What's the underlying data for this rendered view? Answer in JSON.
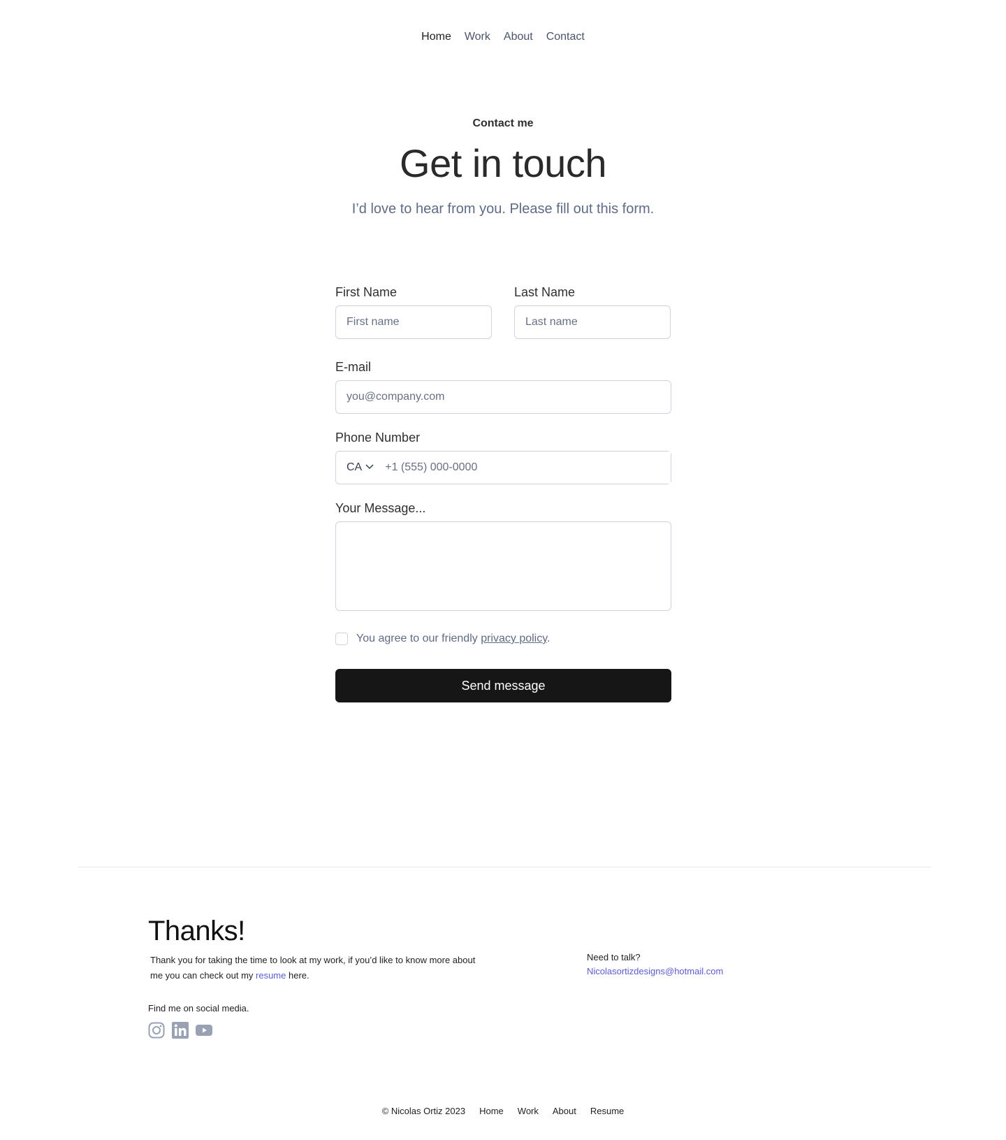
{
  "nav": {
    "items": [
      {
        "label": "Home",
        "active": true
      },
      {
        "label": "Work"
      },
      {
        "label": "About"
      },
      {
        "label": "Contact"
      }
    ]
  },
  "hero": {
    "eyebrow": "Contact me",
    "title": "Get in touch",
    "subtitle": "I’d love to hear from you. Please fill out this form."
  },
  "form": {
    "first_name": {
      "label": "First Name",
      "placeholder": "First name"
    },
    "last_name": {
      "label": "Last Name",
      "placeholder": "Last name"
    },
    "email": {
      "label": "E-mail",
      "placeholder": "you@company.com"
    },
    "phone": {
      "label": "Phone Number",
      "country": "CA",
      "placeholder": "+1 (555) 000-0000"
    },
    "message": {
      "label": "Your Message..."
    },
    "agree": {
      "prefix": "You agree to our friendly ",
      "link": "privacy policy",
      "suffix": "."
    },
    "submit": "Send message"
  },
  "footer": {
    "thanks_title": "Thanks!",
    "thanks_text_1": "Thank you for taking the time to look at my work, if you’d like to know more about me you can check out my ",
    "resume_link": "resume",
    "thanks_text_2": " here.",
    "social_title": "Find me on social media.",
    "social_icons": [
      "instagram-icon",
      "linkedin-icon",
      "youtube-icon"
    ],
    "need_to_talk": "Need to talk?",
    "email": "Nicolasortizdesigns@hotmail.com",
    "copyright": "© Nicolas Ortiz 2023",
    "links": [
      "Home",
      "Work",
      "About",
      "Resume"
    ]
  },
  "colors": {
    "accent": "#5b5bd6",
    "button": "#161616",
    "muted": "#5f6b85",
    "icon": "#98a2b3"
  }
}
